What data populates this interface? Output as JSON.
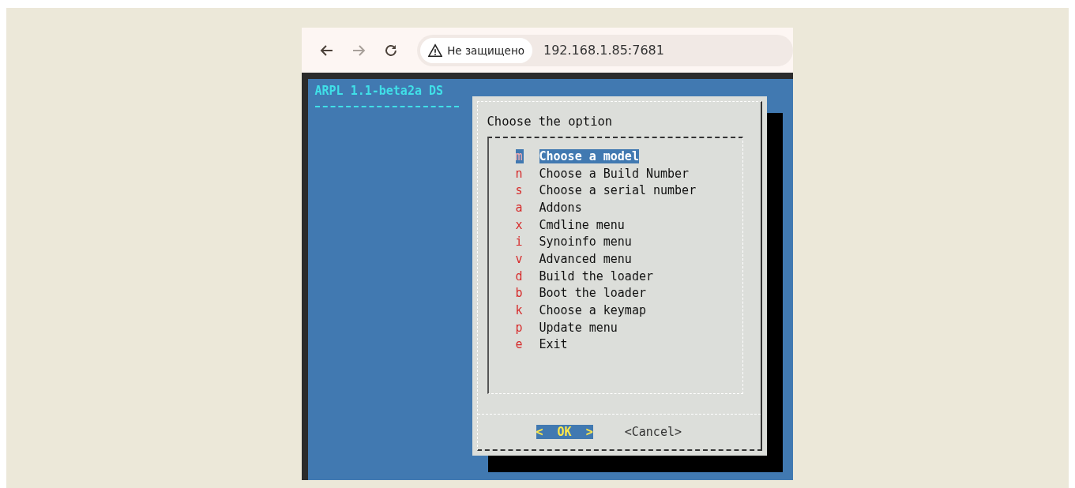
{
  "browser": {
    "security": "Не защищено",
    "address": "192.168.1.85:7681"
  },
  "terminal": {
    "header": "ARPL 1.1-beta2a DS"
  },
  "dialog": {
    "prompt": "Choose the option",
    "items": [
      {
        "key": "m",
        "label": "Choose a model",
        "selected": true
      },
      {
        "key": "n",
        "label": "Choose a Build Number",
        "selected": false
      },
      {
        "key": "s",
        "label": "Choose a serial number",
        "selected": false
      },
      {
        "key": "a",
        "label": "Addons",
        "selected": false
      },
      {
        "key": "x",
        "label": "Cmdline menu",
        "selected": false
      },
      {
        "key": "i",
        "label": "Synoinfo menu",
        "selected": false
      },
      {
        "key": "v",
        "label": "Advanced menu",
        "selected": false
      },
      {
        "key": "d",
        "label": "Build the loader",
        "selected": false
      },
      {
        "key": "b",
        "label": "Boot the loader",
        "selected": false
      },
      {
        "key": "k",
        "label": "Choose a keymap",
        "selected": false
      },
      {
        "key": "p",
        "label": "Update menu",
        "selected": false
      },
      {
        "key": "e",
        "label": "Exit",
        "selected": false
      }
    ],
    "buttons": [
      {
        "label": "<  OK  >",
        "selected": true
      },
      {
        "label": "<Cancel>",
        "selected": false
      }
    ]
  }
}
